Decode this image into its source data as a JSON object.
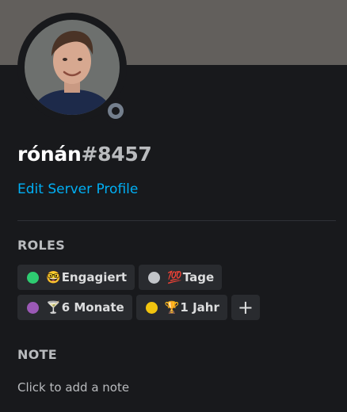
{
  "profile": {
    "name": "rónán",
    "discriminator": "#8457",
    "edit_profile_label": "Edit Server Profile",
    "status": "offline",
    "banner_color": "#625f5c"
  },
  "roles": {
    "title": "ROLES",
    "rows": [
      [
        {
          "name": "Engagiert",
          "emoji": "🤓",
          "color": "#2ecc71"
        },
        {
          "name": "Tage",
          "emoji": "💯",
          "color": "#c2c5c9"
        }
      ],
      [
        {
          "name": "6 Monate",
          "emoji": "🍸",
          "color": "#9b59b6"
        },
        {
          "name": "1 Jahr",
          "emoji": "🏆",
          "color": "#f1c40f"
        }
      ]
    ],
    "add_label": "+"
  },
  "note": {
    "title": "NOTE",
    "placeholder": "Click to add a note"
  }
}
